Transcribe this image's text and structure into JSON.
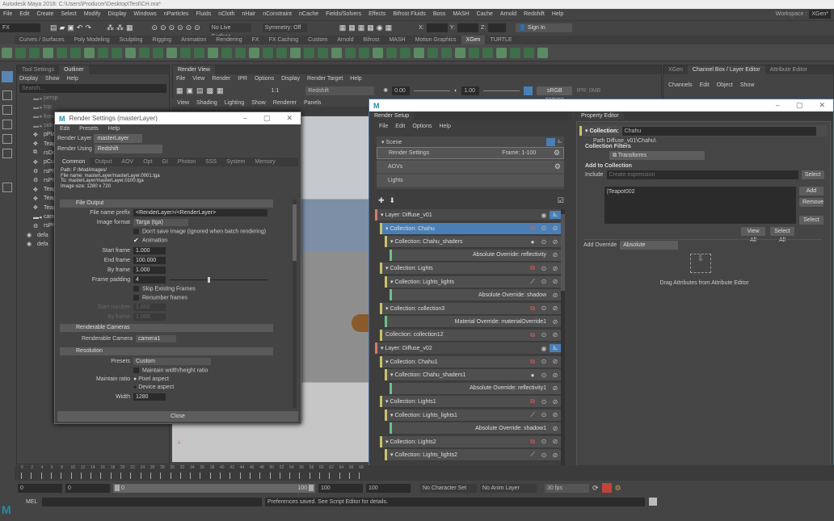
{
  "app_title": "Autodesk Maya 2018: C:\\Users\\Producer\\Desktop\\Test\\CH.ma*",
  "menus": [
    "File",
    "Edit",
    "Create",
    "Select",
    "Modify",
    "Display",
    "Windows",
    "nParticles",
    "Fluids",
    "nCloth",
    "nHair",
    "nConstraint",
    "nCache",
    "Fields/Solvers",
    "Effects",
    "Bifrost Fluids",
    "Boss",
    "MASH",
    "Cache",
    "Arnold",
    "Redshift",
    "Help"
  ],
  "workspace": {
    "label": "Workspace :",
    "value": "XGen*"
  },
  "toolbar": {
    "menuset": "FX",
    "live_surface": "No Live Surface",
    "symmetry": "Symmetry: Off",
    "x": "X:",
    "y": "Y:",
    "z": "Z:",
    "sign_in": "Sign In"
  },
  "shelf_tabs": [
    "Curves / Surfaces",
    "Poly Modeling",
    "Sculpting",
    "Rigging",
    "Animation",
    "Rendering",
    "FX",
    "FX Caching",
    "Custom",
    "Arnold",
    "Bifrost",
    "MASH",
    "Motion Graphics",
    "XGen",
    "TURTLE"
  ],
  "shelf_active": "XGen",
  "outliner": {
    "tabs": [
      "Tool Settings",
      "Outliner"
    ],
    "menu": [
      "Display",
      "Show",
      "Help"
    ],
    "search_placeholder": "Search...",
    "items": [
      {
        "n": "persp",
        "i": "cam"
      },
      {
        "n": "top",
        "i": "cam"
      },
      {
        "n": "front",
        "i": "cam"
      },
      {
        "n": "side",
        "i": "cam"
      },
      {
        "n": "pPla",
        "i": "xf"
      },
      {
        "n": "Teap",
        "i": "xf"
      },
      {
        "n": "rsDo",
        "i": "light"
      },
      {
        "n": "pCub",
        "i": "xf"
      },
      {
        "n": "rsPhy",
        "i": "sky"
      },
      {
        "n": "rsPhy",
        "i": "sky"
      },
      {
        "n": "Teap",
        "i": "xf"
      },
      {
        "n": "Teap",
        "i": "xf"
      },
      {
        "n": "Teap",
        "i": "xf"
      },
      {
        "n": "came",
        "i": "cam"
      },
      {
        "n": "rsPhy",
        "i": "sky"
      },
      {
        "n": "defa",
        "i": "set"
      },
      {
        "n": "defa",
        "i": "set"
      }
    ]
  },
  "render_view": {
    "title": "Render View",
    "menu": [
      "File",
      "View",
      "Render",
      "IPR",
      "Options",
      "Display",
      "Render Target",
      "Help"
    ],
    "renderer": "Redshift",
    "ratio": "1:1",
    "exposure": "0.00",
    "gamma": "1.00",
    "color_space": "sRGB gamma",
    "ipr": "IPR: 0MB"
  },
  "viewport": {
    "menu": [
      "View",
      "Shading",
      "Lighting",
      "Show",
      "Renderer",
      "Panels"
    ]
  },
  "channel_box": {
    "tabs": [
      "XGen",
      "Channel Box / Layer Editor",
      "Attribute Editor"
    ],
    "menu": [
      "Channels",
      "Edit",
      "Object",
      "Show"
    ]
  },
  "render_settings": {
    "title": "Render Settings (masterLayer)",
    "menu": [
      "Edit",
      "Presets",
      "Help"
    ],
    "render_layer_label": "Render Layer",
    "render_layer": "masterLayer",
    "render_using_label": "Render Using",
    "render_using": "Redshift",
    "tabs": [
      "Common",
      "Output",
      "AOV",
      "Opt",
      "GI",
      "Photon",
      "SSS",
      "System",
      "Memory"
    ],
    "info": [
      "Path: F:/Mod/images/",
      "File name:  masterLayer/masterLayer.0001.tga",
      "To:             masterLayer/masterLayer.0100.tga",
      "Image size: 1280 x 720"
    ],
    "file_output": "File Output",
    "prefix_label": "File name prefix",
    "prefix": "<RenderLayer>/<RenderLayer>",
    "format_label": "Image format",
    "format": "Targa (tga)",
    "dont_save": "Don't save image (ignored when batch rendering)",
    "animation": "Animation",
    "start_label": "Start frame",
    "start": "1.000",
    "end_label": "End frame",
    "end": "100.000",
    "by_label": "By frame",
    "by": "1.000",
    "pad_label": "Frame padding",
    "pad": "4",
    "skip": "Skip Existing Frames",
    "renumber": "Renumber frames",
    "start_num_label": "Start number",
    "start_num": "1.000",
    "by2_label": "By frame",
    "by2": "1.000",
    "cameras_section": "Renderable Cameras",
    "camera_label": "Renderable Camera",
    "camera": "camera1",
    "resolution_section": "Resolution",
    "presets_label": "Presets",
    "presets": "Custom",
    "maintain_wh": "Maintain width/height ratio",
    "maintain_label": "Maintain ratio",
    "pixel_aspect": "Pixel aspect",
    "device_aspect": "Device aspect",
    "width_label": "Width",
    "width": "1280",
    "close": "Close"
  },
  "render_setup": {
    "title": "Render Setup",
    "menu": [
      "File",
      "Edit",
      "Options",
      "Help"
    ],
    "scene": "Scene",
    "render_settings": "Render Settings",
    "frame": "Frame: 1-100",
    "aovs": "AOVs",
    "lights": "Lights",
    "rows": [
      {
        "t": "layer",
        "d": 0,
        "l": "Layer:  Diffuse_v01"
      },
      {
        "t": "coll",
        "d": 1,
        "l": "Collection:  Chahu",
        "ic": "xf",
        "sel": true
      },
      {
        "t": "coll",
        "d": 2,
        "l": "Collection:  Chahu_shaders",
        "ic": "sphere"
      },
      {
        "t": "ovr",
        "d": 3,
        "l": "Absolute Override:  reflectivity"
      },
      {
        "t": "coll",
        "d": 1,
        "l": "Collection:  Lights",
        "ic": "xf"
      },
      {
        "t": "coll",
        "d": 2,
        "l": "Collection:  Lights_lights",
        "ic": "light"
      },
      {
        "t": "ovr",
        "d": 3,
        "l": "Absolute Override:  shadow"
      },
      {
        "t": "coll",
        "d": 1,
        "l": "Collection:  collection3",
        "ic": "xf"
      },
      {
        "t": "ovr",
        "d": 2,
        "l": "Material Override:  materialOverride1"
      },
      {
        "t": "coll",
        "d": 1,
        "l": "Collection:  collection12",
        "ic": "xf",
        "notri": true
      },
      {
        "t": "layer",
        "d": 0,
        "l": "Layer:  Diffuse_v02"
      },
      {
        "t": "coll",
        "d": 1,
        "l": "Collection:  Chahu1",
        "ic": "xf"
      },
      {
        "t": "coll",
        "d": 2,
        "l": "Collection:  Chahu_shaders1",
        "ic": "sphere"
      },
      {
        "t": "ovr",
        "d": 3,
        "l": "Absolute Override:  reflectivity1"
      },
      {
        "t": "coll",
        "d": 1,
        "l": "Collection:  Lights1",
        "ic": "xf"
      },
      {
        "t": "coll",
        "d": 2,
        "l": "Collection:  Lights_lights1",
        "ic": "light"
      },
      {
        "t": "ovr",
        "d": 3,
        "l": "Absolute Override:  shadow1"
      },
      {
        "t": "coll",
        "d": 1,
        "l": "Collection:  Lights2",
        "ic": "xf"
      },
      {
        "t": "coll",
        "d": 2,
        "l": "Collection:  Lights_lights2",
        "ic": "light"
      }
    ]
  },
  "property_editor": {
    "title": "Property Editor",
    "collection_label": "Collection:",
    "collection": "Chahu",
    "path": "Path  Diffuse_v01\\Chahu\\",
    "filters_label": "Collection Filters",
    "filter": "Transforms",
    "add_label": "Add to Collection",
    "include_label": "Include",
    "include_placeholder": "Create expression",
    "members": "|Teapot002",
    "select": "Select",
    "add": "Add",
    "remove": "Remove",
    "select2": "Select",
    "view_all": "View All",
    "select_all": "Select All",
    "add_override_label": "Add Override",
    "add_override": "Absolute",
    "drag_hint": "Drag Attributes from Attribute Editor"
  },
  "timeline": {
    "ticks": [
      "0",
      "2",
      "4",
      "6",
      "8",
      "10",
      "12",
      "14",
      "16",
      "18",
      "20",
      "22",
      "24",
      "26",
      "28",
      "30",
      "32",
      "34",
      "36",
      "38",
      "40",
      "42",
      "44",
      "46",
      "48",
      "50",
      "52",
      "54",
      "56",
      "58",
      "60",
      "62",
      "64",
      "66",
      "68"
    ]
  },
  "range": {
    "start": "0",
    "anim_start": "0",
    "slider_start": "0",
    "slider_end": "100",
    "end": "100",
    "anim_end": "100",
    "character_set": "No Character Set",
    "anim_layer": "No Anim Layer",
    "fps": "30 fps"
  },
  "command": {
    "lang": "MEL",
    "status": "Preferences saved. See Script Editor for details."
  },
  "colors": {
    "layer": "#d9786a",
    "collection": "#c9c36a",
    "override": "#6fbf8e",
    "selected": "#4a7fb5",
    "accent": "#1e8ea8"
  }
}
